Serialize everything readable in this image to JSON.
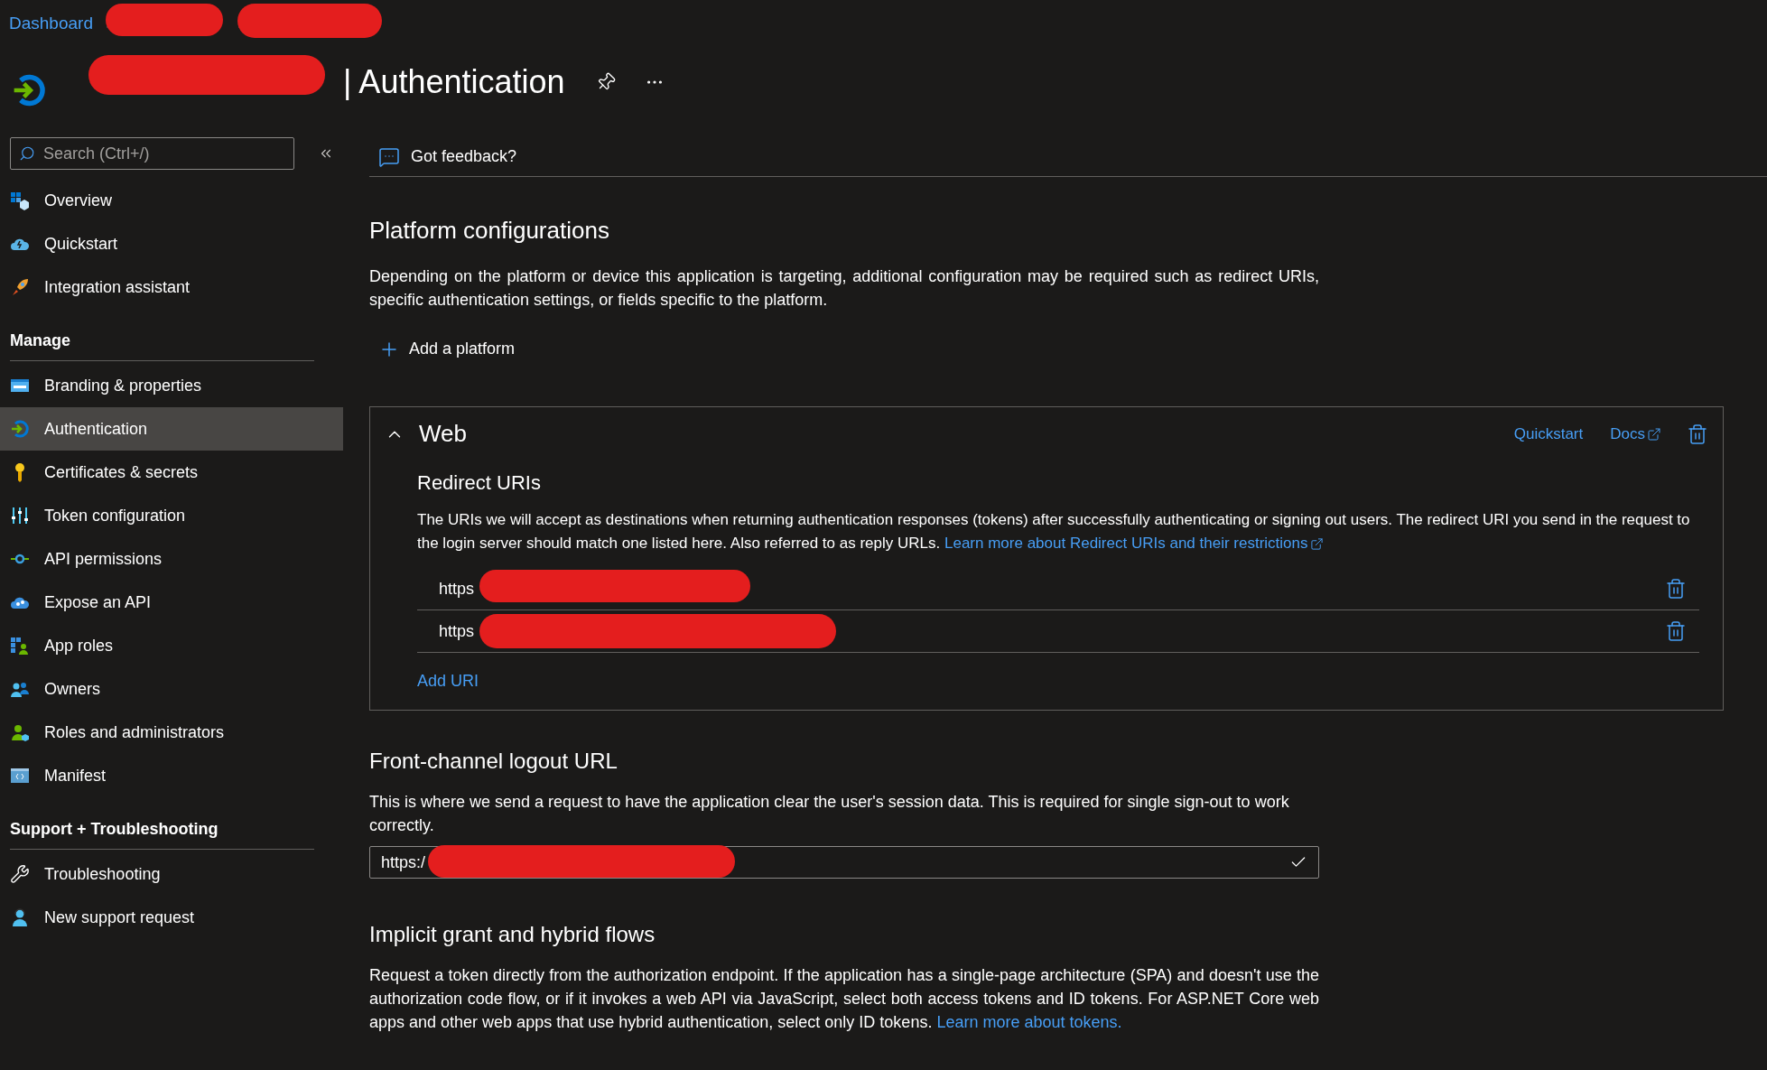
{
  "breadcrumb": {
    "items": [
      "Dashboard"
    ]
  },
  "header": {
    "title": "| Authentication"
  },
  "sidebar": {
    "search": {
      "placeholder": "Search (Ctrl+/)"
    },
    "groups": [
      {
        "items": [
          {
            "label": "Overview",
            "selected": false
          },
          {
            "label": "Quickstart",
            "selected": false
          },
          {
            "label": "Integration assistant",
            "selected": false
          }
        ]
      },
      {
        "title": "Manage",
        "items": [
          {
            "label": "Branding & properties",
            "selected": false
          },
          {
            "label": "Authentication",
            "selected": true
          },
          {
            "label": "Certificates & secrets",
            "selected": false
          },
          {
            "label": "Token configuration",
            "selected": false
          },
          {
            "label": "API permissions",
            "selected": false
          },
          {
            "label": "Expose an API",
            "selected": false
          },
          {
            "label": "App roles",
            "selected": false
          },
          {
            "label": "Owners",
            "selected": false
          },
          {
            "label": "Roles and administrators",
            "selected": false
          },
          {
            "label": "Manifest",
            "selected": false
          }
        ]
      },
      {
        "title": "Support + Troubleshooting",
        "items": [
          {
            "label": "Troubleshooting",
            "selected": false
          },
          {
            "label": "New support request",
            "selected": false
          }
        ]
      }
    ]
  },
  "toolbar": {
    "feedback": "Got feedback?"
  },
  "platform": {
    "title": "Platform configurations",
    "description": "Depending on the platform or device this application is targeting, additional configuration may be required such as redirect URIs, specific authentication settings, or fields specific to the platform.",
    "add_button": "Add a platform"
  },
  "web": {
    "title": "Web",
    "expanded": true,
    "quickstart": "Quickstart",
    "docs": "Docs",
    "redirect_title": "Redirect URIs",
    "redirect_description": {
      "text": "The URIs we will accept as destinations when returning authentication responses (tokens) after successfully authenticating or signing out users. The redirect URI you send in the request to the login server should match one listed here. Also referred to as reply URLs.",
      "link": "Learn more about Redirect URIs and their restrictions"
    },
    "uris": [
      "https",
      "https"
    ],
    "add_uri": "Add URI"
  },
  "logout": {
    "title": "Front-channel logout URL",
    "description": "This is where we send a request to have the application clear the user's session data. This is required for single sign-out to work correctly.",
    "value": "https:/",
    "valid": true
  },
  "implicit": {
    "title": "Implicit grant and hybrid flows",
    "description": {
      "text": "Request a token directly from the authorization endpoint. If the application has a single-page architecture (SPA) and doesn't use the authorization code flow, or if it invokes a web API via JavaScript, select both access tokens and ID tokens. For ASP.NET Core web apps and other web apps that use hybrid authentication, select only ID tokens.",
      "link": "Learn more about tokens."
    }
  }
}
